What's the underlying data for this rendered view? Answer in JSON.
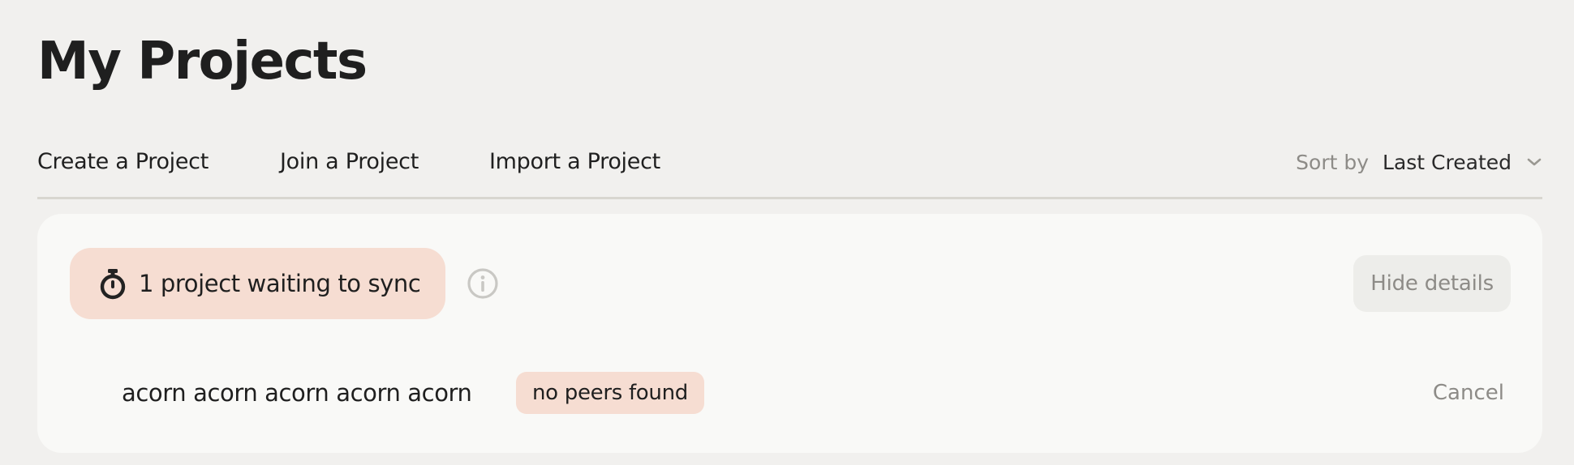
{
  "page": {
    "title": "My Projects"
  },
  "actions": {
    "create_label": "Create a Project",
    "join_label": "Join a Project",
    "import_label": "Import a Project"
  },
  "sort": {
    "label": "Sort by",
    "value": "Last Created"
  },
  "sync_panel": {
    "status_text": "1 project waiting to sync",
    "status_icon": "stopwatch-icon",
    "info_icon": "info-icon",
    "hide_details_label": "Hide details",
    "projects": [
      {
        "name": "acorn acorn acorn acorn acorn",
        "status": "no peers found",
        "cancel_label": "Cancel"
      }
    ]
  },
  "colors": {
    "page_background": "#f1f0ee",
    "card_background": "#f9f9f7",
    "accent_pill": "#f6ddd2",
    "muted_text": "#8d8b87",
    "primary_text": "#1f1f1f"
  }
}
